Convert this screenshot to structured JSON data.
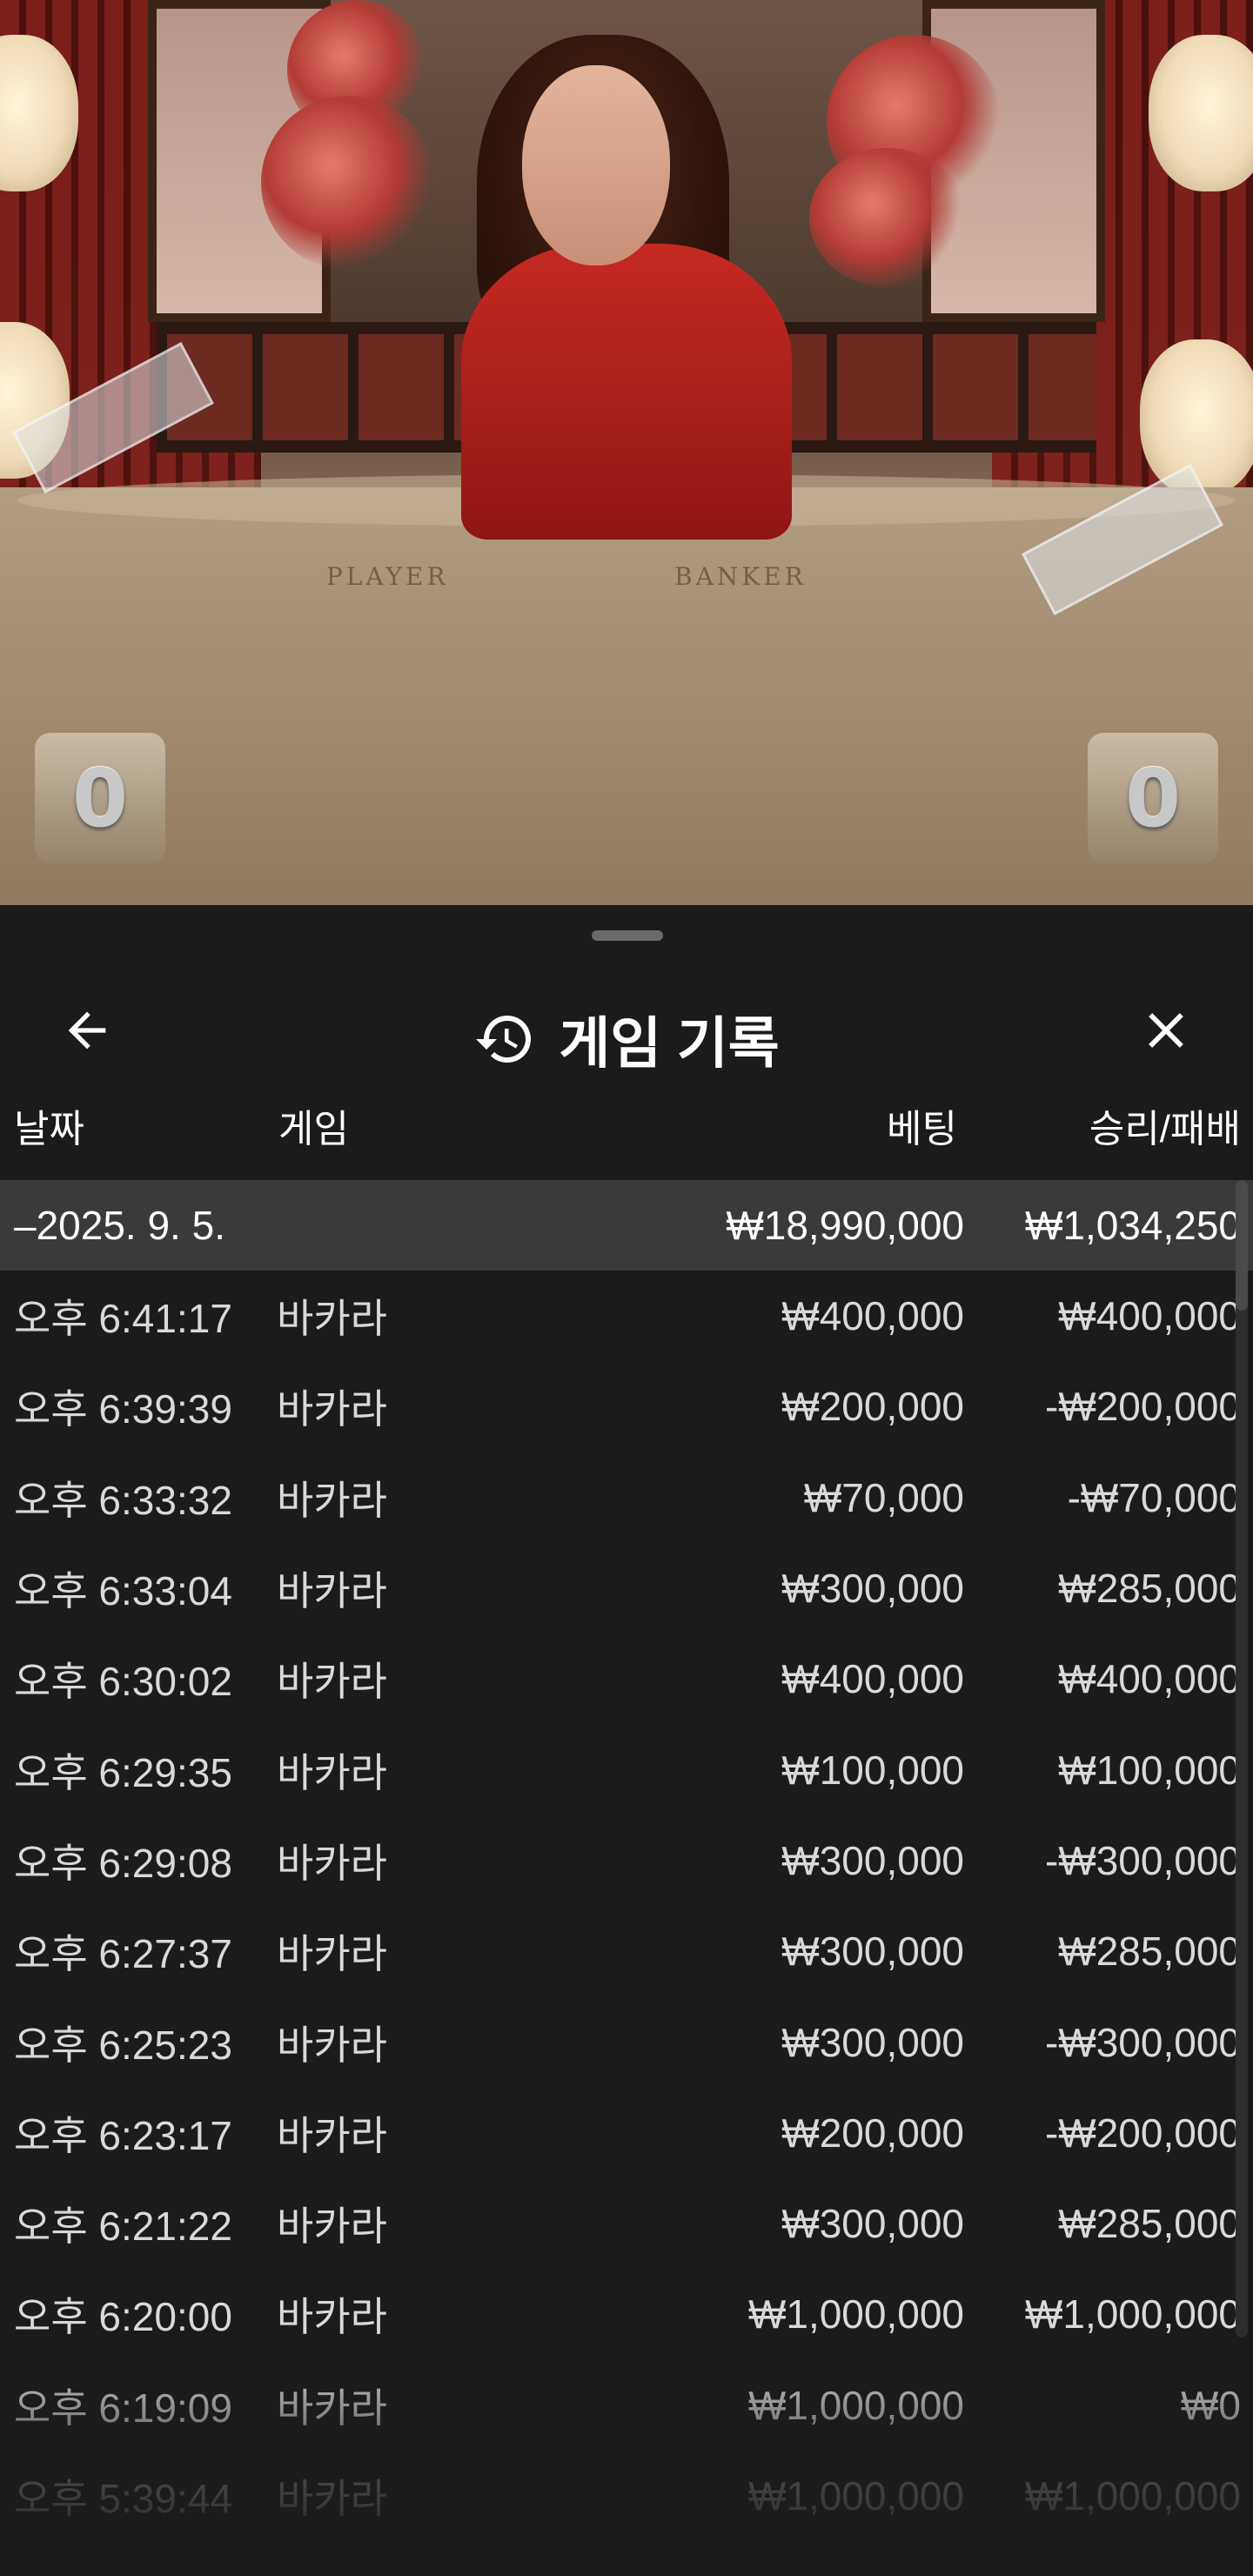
{
  "video": {
    "table_labels": [
      "PLAYER",
      "BANKER"
    ],
    "player_score": "0",
    "banker_score": "0"
  },
  "sheet": {
    "title": "게임 기록",
    "icons": {
      "back": "arrow-left-icon",
      "history": "history-clock-icon",
      "close": "close-icon"
    },
    "columns": {
      "date": "날짜",
      "game": "게임",
      "bet": "베팅",
      "result": "승리/패배"
    },
    "summary": {
      "date": "–2025. 9. 5.",
      "bet": "₩18,990,000",
      "result": "₩1,034,250"
    },
    "rows": [
      {
        "time": "오후 6:41:17",
        "game": "바카라",
        "bet": "₩400,000",
        "result": "₩400,000"
      },
      {
        "time": "오후 6:39:39",
        "game": "바카라",
        "bet": "₩200,000",
        "result": "-₩200,000"
      },
      {
        "time": "오후 6:33:32",
        "game": "바카라",
        "bet": "₩70,000",
        "result": "-₩70,000"
      },
      {
        "time": "오후 6:33:04",
        "game": "바카라",
        "bet": "₩300,000",
        "result": "₩285,000"
      },
      {
        "time": "오후 6:30:02",
        "game": "바카라",
        "bet": "₩400,000",
        "result": "₩400,000"
      },
      {
        "time": "오후 6:29:35",
        "game": "바카라",
        "bet": "₩100,000",
        "result": "₩100,000"
      },
      {
        "time": "오후 6:29:08",
        "game": "바카라",
        "bet": "₩300,000",
        "result": "-₩300,000"
      },
      {
        "time": "오후 6:27:37",
        "game": "바카라",
        "bet": "₩300,000",
        "result": "₩285,000"
      },
      {
        "time": "오후 6:25:23",
        "game": "바카라",
        "bet": "₩300,000",
        "result": "-₩300,000"
      },
      {
        "time": "오후 6:23:17",
        "game": "바카라",
        "bet": "₩200,000",
        "result": "-₩200,000"
      },
      {
        "time": "오후 6:21:22",
        "game": "바카라",
        "bet": "₩300,000",
        "result": "₩285,000"
      },
      {
        "time": "오후 6:20:00",
        "game": "바카라",
        "bet": "₩1,000,000",
        "result": "₩1,000,000"
      },
      {
        "time": "오후 6:19:09",
        "game": "바카라",
        "bet": "₩1,000,000",
        "result": "₩0"
      },
      {
        "time": "오후 5:39:44",
        "game": "바카라",
        "bet": "₩1,000,000",
        "result": "₩1,000,000"
      }
    ]
  }
}
